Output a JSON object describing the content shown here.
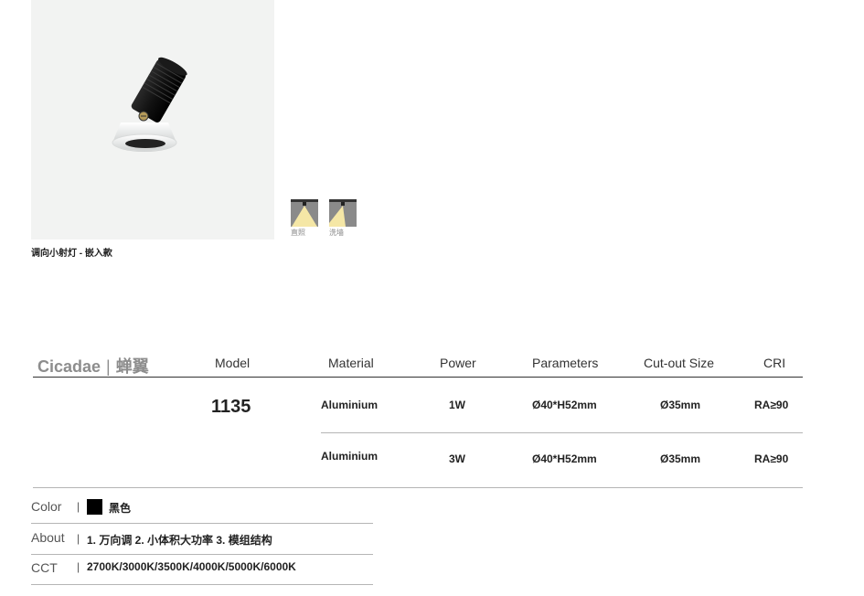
{
  "product": {
    "caption": "调向小射灯 - 嵌入款",
    "beam_options": [
      {
        "label": "直照",
        "icon": "direct-beam-icon"
      },
      {
        "label": "洗墙",
        "icon": "wall-wash-icon"
      }
    ]
  },
  "brand": {
    "name_en": "Cicadae",
    "separator": "|",
    "name_cn": "蝉翼"
  },
  "table": {
    "headers": {
      "model": "Model",
      "material": "Material",
      "power": "Power",
      "parameters": "Parameters",
      "cut_out": "Cut-out Size",
      "cri": "CRI"
    },
    "model_no": "1135",
    "rows": [
      {
        "material": "Aluminium",
        "power": "1W",
        "parameters": "Ø40*H52mm",
        "cut_out": "Ø35mm",
        "cri": "RA≥90"
      },
      {
        "material": "Aluminium",
        "power": "3W",
        "parameters": "Ø40*H52mm",
        "cut_out": "Ø35mm",
        "cri": "RA≥90"
      }
    ]
  },
  "attributes": {
    "separator": "|",
    "color_label": "Color",
    "color_value": "黑色",
    "color_swatch": "#000000",
    "about_label": "About",
    "about_value": "1. 万向调  2. 小体积大功率  3. 模组结构",
    "cct_label": "CCT",
    "cct_value": "2700K/3000K/3500K/4000K/5000K/6000K"
  },
  "colors": {
    "brand_grey": "#8d8d8d",
    "beam_light": "#f5e7a6",
    "beam_bg": "#8a8a8a"
  }
}
